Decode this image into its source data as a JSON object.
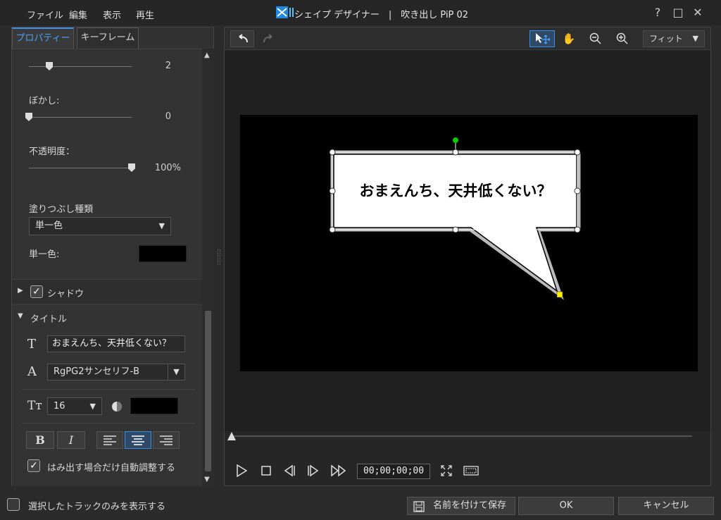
{
  "menu": [
    "ファイル",
    "編集",
    "表示",
    "再生"
  ],
  "app_title": "シェイプ デザイナー　|　吹き出し PiP 02",
  "window_controls": {
    "help": "?",
    "maximize": "□",
    "close": "✕"
  },
  "tabs": [
    {
      "label": "プロパティー",
      "active": true
    },
    {
      "label": "キーフレーム",
      "active": false
    }
  ],
  "properties": {
    "width_value": "2",
    "blur_label": "ぼかし:",
    "blur_value": "0",
    "opacity_label": "不透明度：",
    "opacity_value": "100%",
    "opacity_level": 1.0,
    "fill_type_label": "塗りつぶし種類",
    "fill_type_value": "単一色",
    "solid_color_label": "単一色:",
    "solid_color": "#000000"
  },
  "shadow_section": {
    "label": "シャドウ",
    "checked": true
  },
  "title_section": {
    "label": "タイトル",
    "text_value": "おまえんち、天井低くない？",
    "font_value": "RgPG2サンセリフ-B",
    "size_value": "16",
    "text_color": "#000000",
    "bold_label": "B",
    "italic_label": "I",
    "autofit_label": "はみ出す場合だけ自動調整する",
    "autofit_checked": true
  },
  "toolbar": {
    "zoom_select": "フィット"
  },
  "canvas": {
    "bubble_text": "おまえんち、天井低くない？",
    "background": "#000000",
    "bubble_fill": "#ffffff"
  },
  "player": {
    "timecode": "00;00;00;00"
  },
  "bottom": {
    "show_selected_only_label": "選択したトラックのみを表示する",
    "save_as_label": "名前を付けて保存",
    "ok_label": "OK",
    "cancel_label": "キャンセル"
  },
  "colors": {
    "accent": "#3a8ee6",
    "handle_green": "#00cc00",
    "handle_yellow": "#ffee00"
  }
}
